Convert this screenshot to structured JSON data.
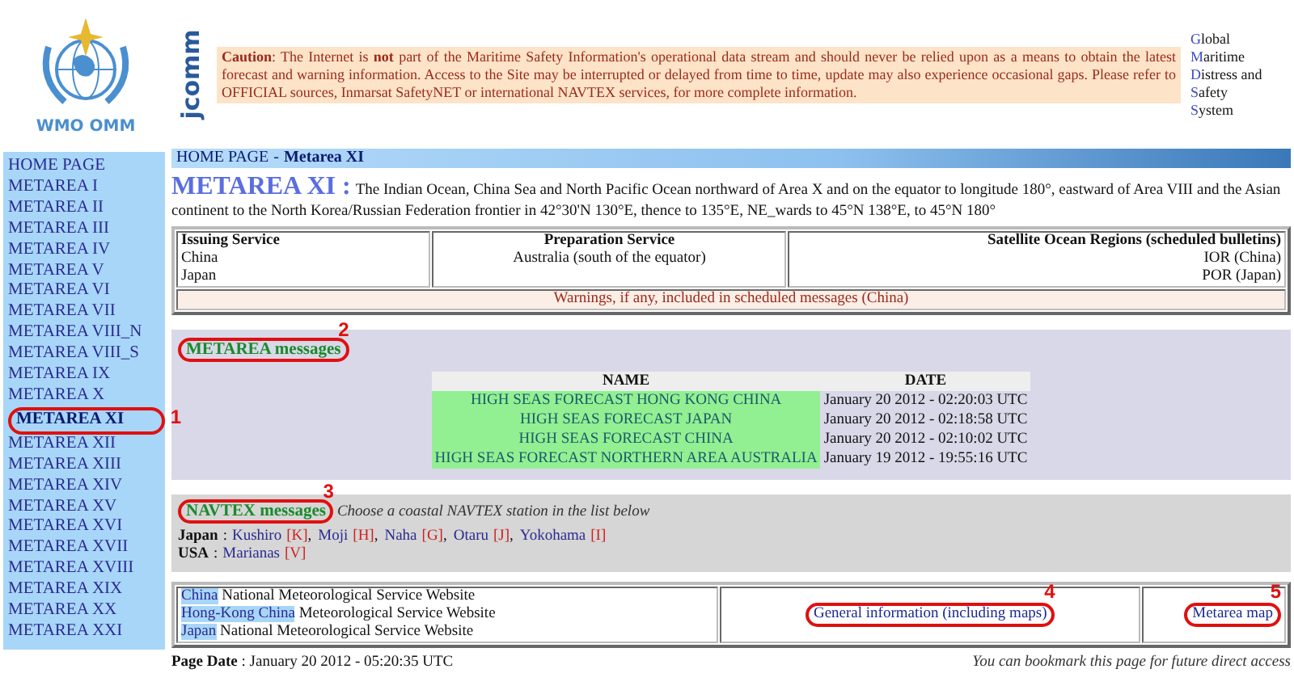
{
  "logo": {
    "caption": "WMO OMM",
    "side_logo": "jcomm"
  },
  "caution": "**Caution**: The Internet is **not** part of the Maritime Safety Information's operational data stream and should never be relied upon as a means to obtain the latest forecast and warning information. Access to the Site may be interrupted or delayed from time to time, update may also experience occasional gaps. Please refer to OFFICIAL sources, Inmarsat SafetyNET or international NAVTEX services, for more complete information.",
  "gmdss": [
    "Global",
    "Maritime",
    "Distress and",
    "Safety",
    "System"
  ],
  "sidebar": {
    "items": [
      {
        "label": "HOME PAGE",
        "selected": false
      },
      {
        "label": "METAREA I",
        "selected": false
      },
      {
        "label": "METAREA II",
        "selected": false
      },
      {
        "label": "METAREA III",
        "selected": false
      },
      {
        "label": "METAREA IV",
        "selected": false
      },
      {
        "label": "METAREA V",
        "selected": false
      },
      {
        "label": "METAREA VI",
        "selected": false
      },
      {
        "label": "METAREA VII",
        "selected": false
      },
      {
        "label": "METAREA VIII_N",
        "selected": false
      },
      {
        "label": "METAREA VIII_S",
        "selected": false
      },
      {
        "label": "METAREA IX",
        "selected": false
      },
      {
        "label": "METAREA X",
        "selected": false
      },
      {
        "label": "METAREA XI",
        "selected": true,
        "callout": "1"
      },
      {
        "label": "METAREA XII",
        "selected": false
      },
      {
        "label": "METAREA XIII",
        "selected": false
      },
      {
        "label": "METAREA XIV",
        "selected": false
      },
      {
        "label": "METAREA XV",
        "selected": false
      },
      {
        "label": "METAREA XVI",
        "selected": false
      },
      {
        "label": "METAREA XVII",
        "selected": false
      },
      {
        "label": "METAREA XVIII",
        "selected": false
      },
      {
        "label": "METAREA XIX",
        "selected": false
      },
      {
        "label": "METAREA XX",
        "selected": false
      },
      {
        "label": "METAREA XXI",
        "selected": false
      }
    ]
  },
  "breadcrumb": {
    "home": "HOME PAGE",
    "separator": "-",
    "current": "Metarea XI"
  },
  "area": {
    "title": "METAREA XI :",
    "description": "The Indian Ocean, China Sea and North Pacific Ocean northward of Area X and on the equator to longitude 180°, eastward of Area VIII and the Asian continent to the North Korea/Russian Federation frontier in 42°30'N 130°E, thence to 135°E, NE_wards to 45°N 138°E, to 45°N 180°"
  },
  "services": {
    "columns": [
      "Issuing Service",
      "Preparation Service",
      "Satellite Ocean Regions (scheduled bulletins)"
    ],
    "issuing": [
      "China",
      "Japan"
    ],
    "preparation": [
      "Australia (south of the equator)"
    ],
    "satellite": [
      "IOR (China)",
      "POR (Japan)"
    ],
    "warnings": "Warnings, if any, included in scheduled messages (China)"
  },
  "metarea_messages": {
    "heading": "METAREA messages",
    "callout": "2",
    "columns": [
      "NAME",
      "DATE"
    ],
    "rows": [
      {
        "name": "HIGH SEAS FORECAST HONG KONG CHINA",
        "date": "January 20 2012 - 02:20:03 UTC"
      },
      {
        "name": "HIGH SEAS FORECAST JAPAN",
        "date": "January 20 2012 - 02:18:58 UTC"
      },
      {
        "name": "HIGH SEAS FORECAST CHINA",
        "date": "January 20 2012 - 02:10:02 UTC"
      },
      {
        "name": "HIGH SEAS FORECAST NORTHERN AREA AUSTRALIA",
        "date": "January 19 2012 - 19:55:16 UTC"
      }
    ]
  },
  "navtex_messages": {
    "heading": "NAVTEX messages",
    "callout": "3",
    "hint": "Choose a coastal NAVTEX station in the list below",
    "countries": [
      {
        "country": "Japan",
        "separator": ":",
        "stations": [
          {
            "name": "Kushiro",
            "code": "[K]",
            "after": ","
          },
          {
            "name": "Moji",
            "code": "[H]",
            "after": ","
          },
          {
            "name": "Naha",
            "code": "[G]",
            "after": ","
          },
          {
            "name": "Otaru",
            "code": "[J]",
            "after": ","
          },
          {
            "name": "Yokohama",
            "code": "[I]"
          }
        ]
      },
      {
        "country": "USA",
        "separator": ":",
        "stations": [
          {
            "name": "Marianas",
            "code": "[V]"
          }
        ]
      }
    ]
  },
  "links": {
    "services": [
      {
        "country": "China",
        "text": "National Meteorological Service Website"
      },
      {
        "country": "Hong-Kong China",
        "text": "Meteorological Service Website"
      },
      {
        "country": "Japan",
        "text": "National Meteorological Service Website"
      }
    ],
    "general": {
      "label": "General information (including maps)",
      "callout": "4"
    },
    "map": {
      "label": "Metarea map",
      "callout": "5"
    }
  },
  "footer": {
    "label": "Page Date",
    "separator": ":",
    "date": "January 20 2012 - 05:20:35 UTC",
    "note": "You can bookmark this page for future direct access"
  }
}
